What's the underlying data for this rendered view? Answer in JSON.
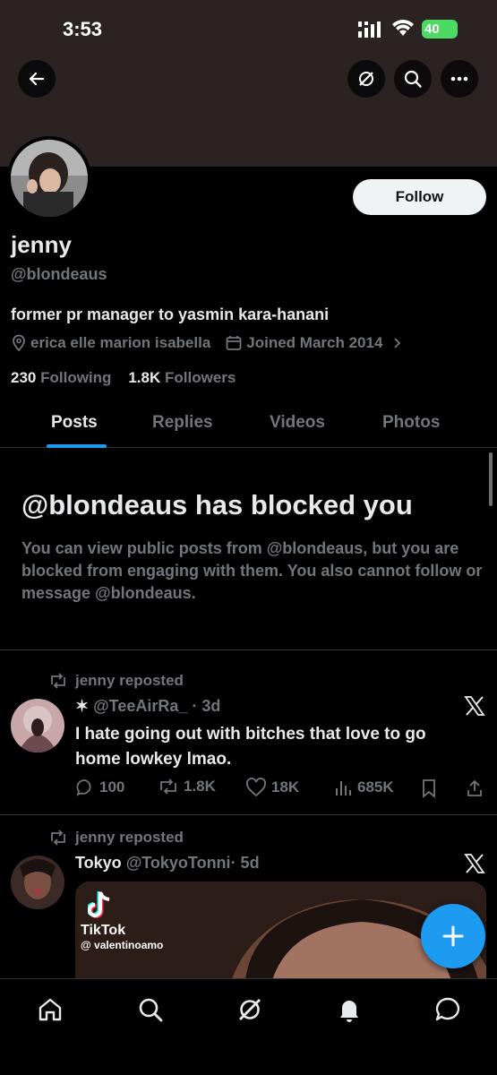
{
  "status_bar": {
    "time": "3:53",
    "battery": "40"
  },
  "profile": {
    "name": "jenny",
    "handle": "@bIondeaus",
    "bio": "former pr manager to yasmin kara-hanani",
    "location": "erica elle marion isabella",
    "joined": "Joined March 2014",
    "following_count": "230",
    "following_label": "Following",
    "followers_count": "1.8K",
    "followers_label": "Followers",
    "follow_button": "Follow"
  },
  "tabs": [
    {
      "label": "Posts",
      "active": true
    },
    {
      "label": "Replies",
      "active": false
    },
    {
      "label": "Videos",
      "active": false
    },
    {
      "label": "Photos",
      "active": false
    }
  ],
  "blocked": {
    "title": "@blondeaus has blocked you",
    "body": "You can view public posts from @blondeaus, but you are blocked from engaging with them. You also cannot follow or message @blondeaus."
  },
  "posts": [
    {
      "repost_label": "jenny reposted",
      "author_name": "✶",
      "author_handle": "@TeeAirRa_",
      "time": "· 3d",
      "text": "I hate going out with bitches that love to go home lowkey lmao.",
      "replies": "100",
      "reposts": "1.8K",
      "likes": "18K",
      "views": "685K"
    },
    {
      "repost_label": "jenny reposted",
      "author_name": "Tokyo",
      "author_handle": "@TokyoTonni",
      "time": "· 5d",
      "media_brand": "TikTok",
      "media_user": "@ valentinoamo"
    }
  ],
  "colors": {
    "accent": "#1d9bf0",
    "muted": "#71767b",
    "text": "#e7e9ea",
    "banner": "#2a2322"
  },
  "icons": [
    "back-arrow-icon",
    "grok-icon",
    "search-icon",
    "more-icon",
    "location-icon",
    "calendar-icon",
    "chevron-right-icon",
    "repost-icon",
    "x-logo-icon",
    "reply-icon",
    "like-icon",
    "views-icon",
    "bookmark-icon",
    "share-icon",
    "tiktok-icon",
    "plus-icon",
    "home-icon",
    "notifications-icon",
    "messages-icon"
  ]
}
